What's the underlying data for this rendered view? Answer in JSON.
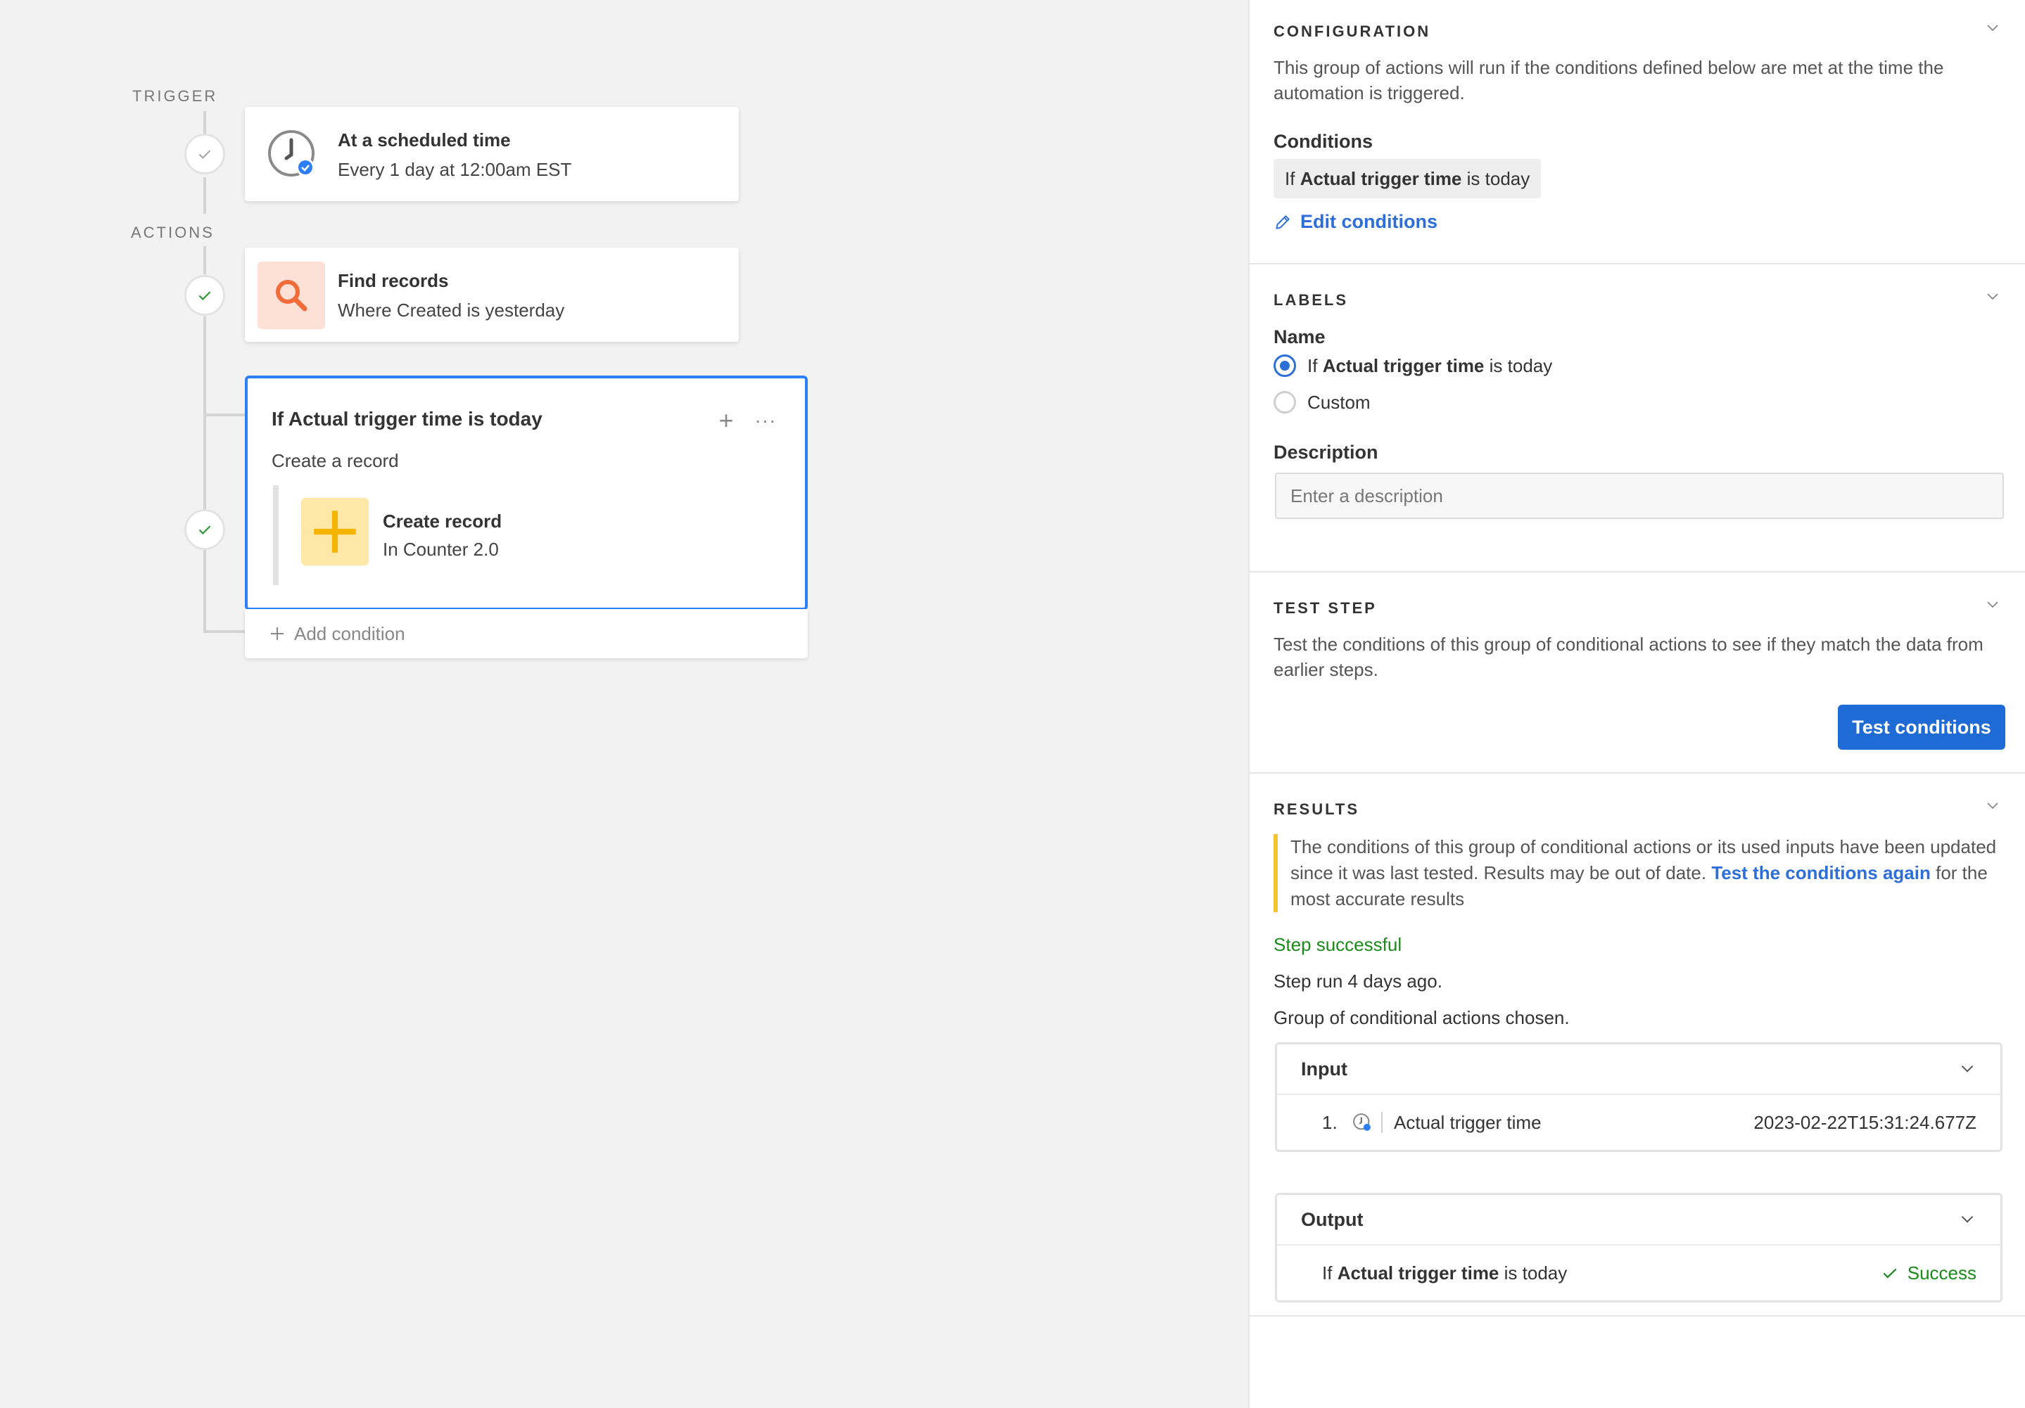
{
  "canvas": {
    "trigger_label": "TRIGGER",
    "actions_label": "ACTIONS",
    "trigger_card": {
      "title": "At a scheduled time",
      "subtitle": "Every 1 day at 12:00am EST",
      "icon": "clock-icon"
    },
    "find_card": {
      "title": "Find records",
      "subtitle": "Where Created is yesterday",
      "icon": "search-icon",
      "icon_bg": "#fde0d6",
      "icon_color": "#f26b3a"
    },
    "condition_card": {
      "title": "If Actual trigger time is today",
      "subtitle": "Create a record",
      "plus": "+",
      "more": "···",
      "inner": {
        "title": "Create record",
        "subtitle": "In Counter 2.0",
        "icon": "plus-icon",
        "icon_bg": "#fde8a8",
        "icon_color": "#f5b400"
      }
    },
    "add_condition": "Add condition"
  },
  "panel": {
    "configuration": {
      "heading": "CONFIGURATION",
      "description": "This group of actions will run if the conditions defined below are met at the time the automation is triggered.",
      "conditions_label": "Conditions",
      "condition_pill": {
        "prefix": "If",
        "field": "Actual trigger time",
        "suffix": "is today"
      },
      "edit_link": "Edit conditions"
    },
    "labels": {
      "heading": "LABELS",
      "name_label": "Name",
      "option_default": {
        "prefix": "If",
        "field": "Actual trigger time",
        "suffix": "is today",
        "selected": true
      },
      "option_custom": "Custom",
      "description_label": "Description",
      "description_placeholder": "Enter a description"
    },
    "test_step": {
      "heading": "TEST STEP",
      "description": "Test the conditions of this group of conditional actions to see if they match the data from earlier steps.",
      "button": "Test conditions"
    },
    "results": {
      "heading": "RESULTS",
      "warning_text": "The conditions of this group of conditional actions or its used inputs have been updated since it was last tested. Results may be out of date.",
      "warning_link": "Test the conditions again",
      "warning_tail": "for the most accurate results",
      "status": "Step successful",
      "run_time": "Step run 4 days ago.",
      "chosen": "Group of conditional actions chosen.",
      "input": {
        "title": "Input",
        "rows": [
          {
            "num": "1.",
            "label": "Actual trigger time",
            "value": "2023-02-22T15:31:24.677Z"
          }
        ]
      },
      "output": {
        "title": "Output",
        "row": {
          "prefix": "If",
          "field": "Actual trigger time",
          "suffix": "is today",
          "status": "Success"
        }
      }
    }
  },
  "colors": {
    "accent": "#2d7ff9",
    "link": "#2d6ed8",
    "success": "#1a8a1a",
    "warning": "#f4c430",
    "button": "#1e6bd6"
  }
}
